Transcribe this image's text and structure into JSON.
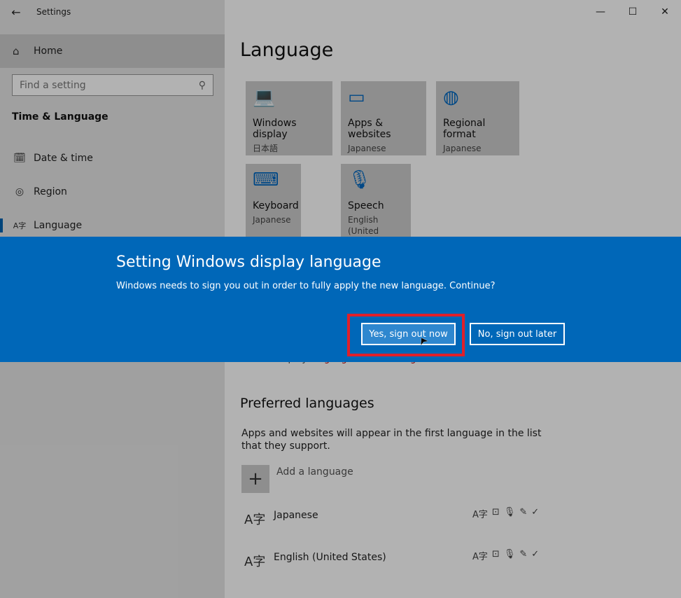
{
  "window": {
    "title": "Settings",
    "back_icon": "←",
    "minimize_icon": "—",
    "maximize_icon": "☐",
    "close_icon": "✕"
  },
  "sidebar": {
    "home_label": "Home",
    "home_icon": "⌂",
    "search_placeholder": "Find a setting",
    "search_icon": "⚲",
    "section_title": "Time & Language",
    "items": [
      {
        "label": "Date & time",
        "icon": "🗓"
      },
      {
        "label": "Region",
        "icon": "◎"
      },
      {
        "label": "Language",
        "icon": "A字"
      }
    ]
  },
  "main": {
    "title": "Language",
    "tiles": [
      {
        "name": "Windows display",
        "sub": "日本語",
        "icon": "💻"
      },
      {
        "name": "Apps & websites",
        "sub": "Japanese",
        "icon": "▭"
      },
      {
        "name": "Regional format",
        "sub": "Japanese",
        "icon": "◍"
      },
      {
        "name": "Keyboard",
        "sub": "Japanese",
        "icon": "⌨"
      },
      {
        "name": "Speech",
        "sub": "English (United States)",
        "icon": "🎙"
      }
    ],
    "behind_text_prefix": "Will be display ",
    "behind_text_red": "language after next sign-in",
    "preferred_heading": "Preferred languages",
    "preferred_desc": "Apps and websites will appear in the first language in the list that they support.",
    "add_language_label": "Add a language",
    "add_icon": "+",
    "languages": [
      {
        "name": "Japanese",
        "glyph": "A字"
      },
      {
        "name": "English (United States)",
        "glyph": "A字"
      }
    ],
    "feature_icons": [
      "A字",
      "⊡",
      "🎙",
      "✎",
      "✓"
    ]
  },
  "dialog": {
    "title": "Setting Windows display language",
    "message": "Windows needs to sign you out in order to fully apply the new language. Continue?",
    "primary_button": "Yes, sign out now",
    "secondary_button": "No, sign out later",
    "cursor_icon": "➤"
  },
  "colors": {
    "accent": "#0067b8",
    "highlight": "#e0202a"
  }
}
